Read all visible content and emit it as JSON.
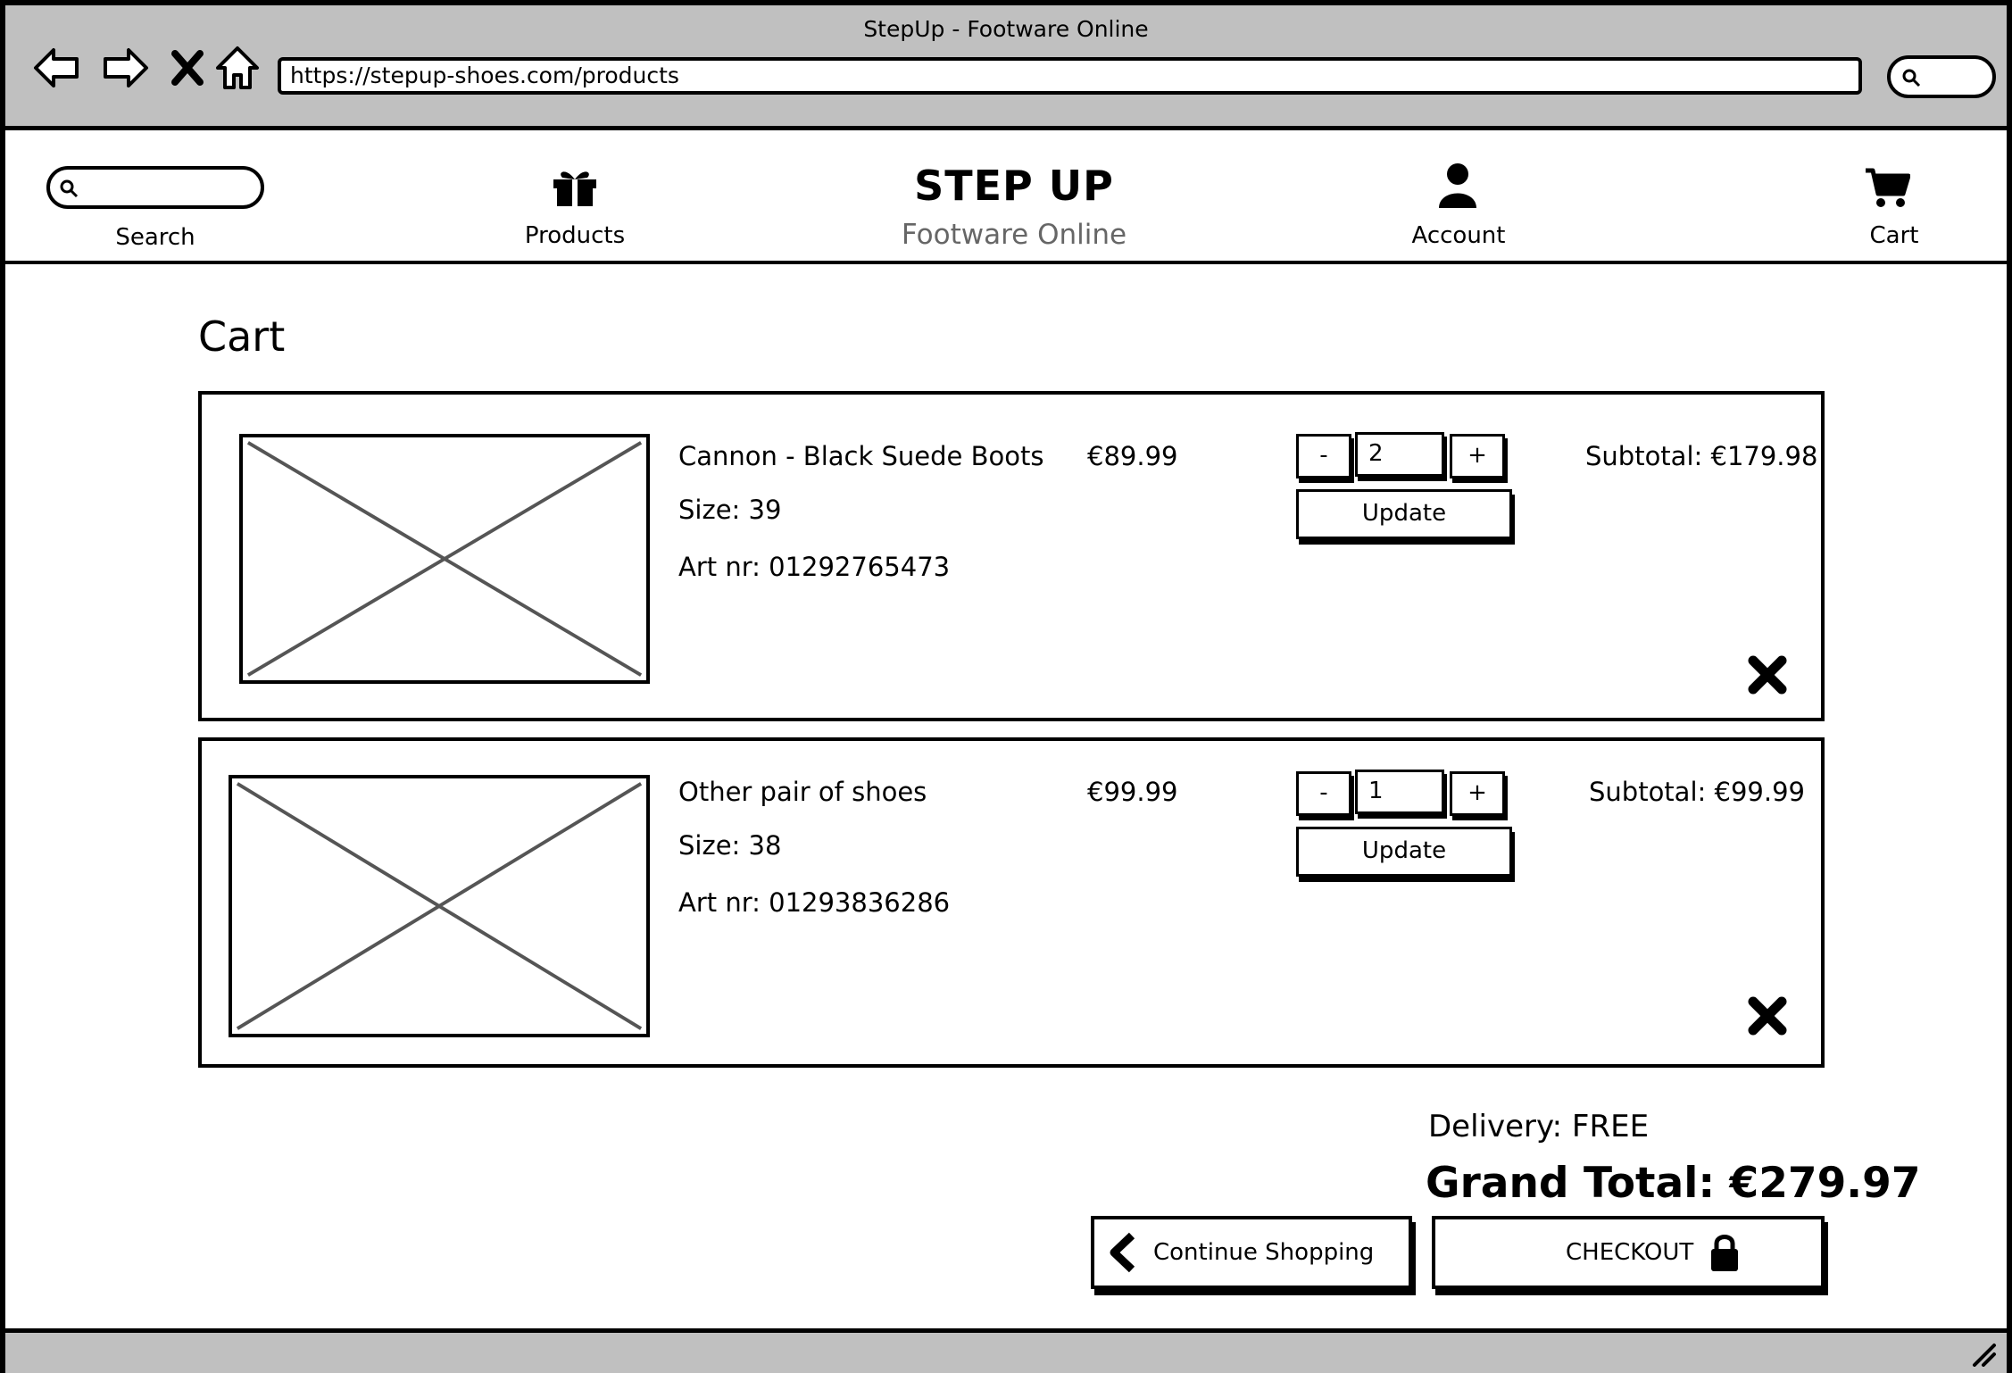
{
  "browser": {
    "window_title": "StepUp - Footware Online",
    "url": "https://stepup-shoes.com/products",
    "nav_icons": [
      "back-arrow-icon",
      "forward-arrow-icon",
      "close-x-icon",
      "home-icon"
    ]
  },
  "header": {
    "search_label": "Search",
    "products_label": "Products",
    "brand_title": "STEP UP",
    "brand_subtitle": "Footware Online",
    "account_label": "Account",
    "cart_label": "Cart"
  },
  "main": {
    "heading": "Cart",
    "items": [
      {
        "name": "Cannon - Black Suede Boots",
        "price": "€89.99",
        "size": "Size: 39",
        "art_nr": "Art nr: 01292765473",
        "minus_label": "-",
        "quantity": "2",
        "plus_label": "+",
        "update_label": "Update",
        "subtotal": "Subtotal: €179.98"
      },
      {
        "name": "Other pair of shoes",
        "price": "€99.99",
        "size": "Size: 38",
        "art_nr": "Art nr: 01293836286",
        "minus_label": "-",
        "quantity": "1",
        "plus_label": "+",
        "update_label": "Update",
        "subtotal": "Subtotal: €99.99"
      }
    ],
    "delivery": "Delivery: FREE",
    "grand_total": "Grand Total: €279.97",
    "continue_label": "Continue Shopping",
    "checkout_label": "CHECKOUT"
  },
  "colors": {
    "chrome_bg": "#c0c0c0",
    "border": "#000000",
    "subtitle": "#666666",
    "placeholder_x": "#555555"
  }
}
